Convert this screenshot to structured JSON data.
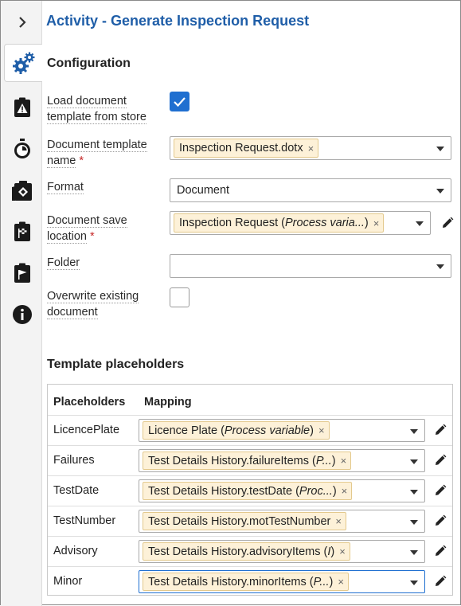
{
  "sidebar": {
    "toggle_icon": "chevron-right-icon",
    "items": [
      {
        "icon": "gears-icon",
        "active": true
      },
      {
        "icon": "warning-clipboard-icon"
      },
      {
        "icon": "stopwatch-icon"
      },
      {
        "icon": "map-clipboard-icon"
      },
      {
        "icon": "checkered-flag-clipboard-icon"
      },
      {
        "icon": "flag-clipboard-icon"
      },
      {
        "icon": "info-icon"
      }
    ]
  },
  "header": {
    "title": "Activity  - Generate Inspection Request"
  },
  "configuration": {
    "heading": "Configuration",
    "load_template": {
      "label": "Load document template from store",
      "checked": true
    },
    "template_name": {
      "label": "Document template name",
      "required_mark": "*",
      "chip": "Inspection Request.dotx",
      "chip_remove": "×"
    },
    "format": {
      "label": "Format",
      "value": "Document"
    },
    "save_location": {
      "label": "Document save location",
      "required_mark": "*",
      "chip_text": "Inspection Request (",
      "chip_italic": "Process varia...",
      "chip_suffix": " )",
      "chip_remove": "×"
    },
    "folder": {
      "label": "Folder",
      "value": ""
    },
    "overwrite": {
      "label": "Overwrite existing document",
      "checked": false
    }
  },
  "placeholders": {
    "heading": "Template placeholders",
    "col_placeholders": "Placeholders",
    "col_mapping": "Mapping",
    "rows": [
      {
        "name": "LicencePlate",
        "chip_text": "Licence Plate (",
        "chip_italic": "Process variable",
        "chip_suffix": ")",
        "chip_remove": "×"
      },
      {
        "name": "Failures",
        "chip_text": "Test Details History.failureItems (",
        "chip_italic": "P...",
        "chip_suffix": ")",
        "chip_remove": "×"
      },
      {
        "name": "TestDate",
        "chip_text": "Test Details History.testDate (",
        "chip_italic": "Proc...",
        "chip_suffix": ")",
        "chip_remove": "×"
      },
      {
        "name": "TestNumber",
        "chip_text": "Test Details History.motTestNumber",
        "chip_italic": "",
        "chip_suffix": "",
        "chip_remove": "×"
      },
      {
        "name": "Advisory",
        "chip_text": "Test Details History.advisoryItems (",
        "chip_italic": "I",
        "chip_suffix": ")",
        "chip_remove": "×"
      },
      {
        "name": "Minor",
        "chip_text": "Test Details History.minorItems (",
        "chip_italic": "P...",
        "chip_suffix": ")",
        "chip_remove": "×",
        "focused": true
      }
    ]
  },
  "colors": {
    "accent": "#1f6fd0",
    "title": "#1f5ea8",
    "chip_bg": "#fdf1d8",
    "icon": "#1a1a1a"
  }
}
